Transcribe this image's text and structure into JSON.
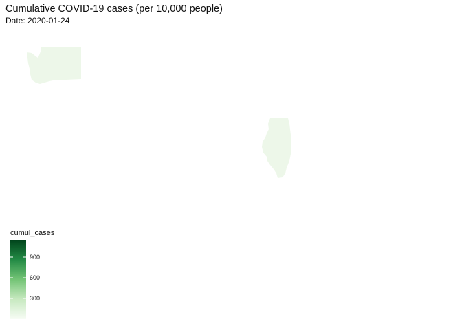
{
  "title": "Cumulative COVID-19 cases (per 10,000 people)",
  "subtitle": "Date: 2020-01-24",
  "map": {
    "regions": [
      {
        "name": "Washington",
        "cumul_cases": 1,
        "fill": "#edf7e9"
      },
      {
        "name": "Illinois",
        "cumul_cases": 1,
        "fill": "#edf7e9"
      }
    ]
  },
  "legend": {
    "title": "cumul_cases",
    "min": 0,
    "max": 1150,
    "breaks": [
      {
        "value": 300,
        "label": "300"
      },
      {
        "value": 600,
        "label": "600"
      },
      {
        "value": 900,
        "label": "900"
      }
    ],
    "color_low": "#f7fcf5",
    "color_high": "#00441b"
  }
}
